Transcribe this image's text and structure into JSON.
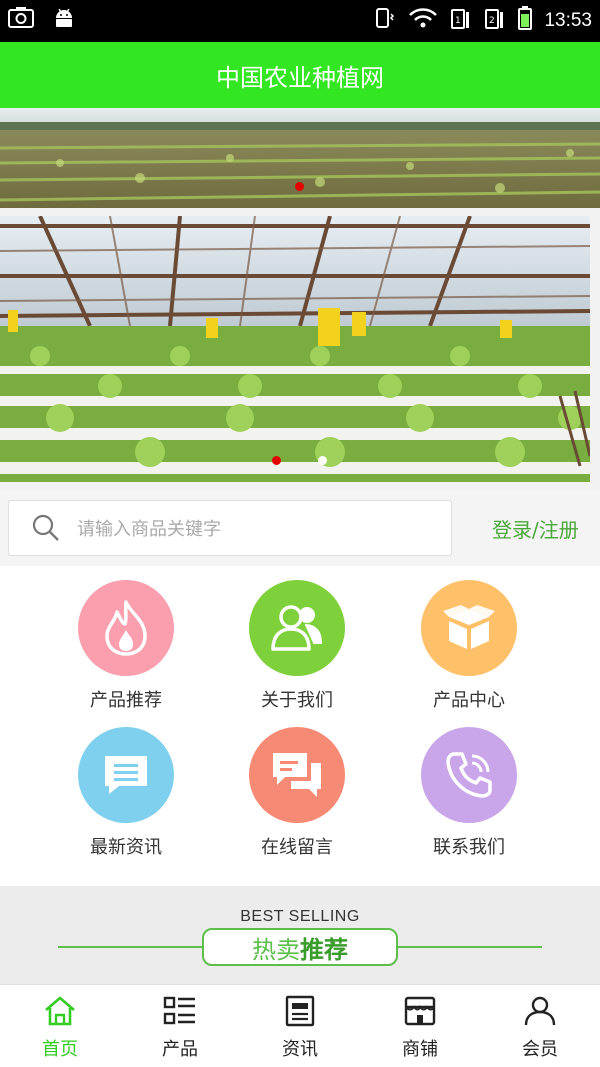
{
  "status": {
    "time": "13:53"
  },
  "header": {
    "title": "中国农业种植网"
  },
  "search": {
    "placeholder": "请输入商品关键字",
    "login_label": "登录/注册"
  },
  "menu": [
    {
      "label": "产品推荐",
      "icon": "fire-icon",
      "color": "#fb9fae"
    },
    {
      "label": "关于我们",
      "icon": "users-icon",
      "color": "#7fd13b"
    },
    {
      "label": "产品中心",
      "icon": "box-icon",
      "color": "#ffc06a"
    },
    {
      "label": "最新资讯",
      "icon": "message-icon",
      "color": "#7fcfef"
    },
    {
      "label": "在线留言",
      "icon": "chat-icon",
      "color": "#f78a74"
    },
    {
      "label": "联系我们",
      "icon": "phone-icon",
      "color": "#c9a6ea"
    }
  ],
  "best_selling": {
    "en": "BEST SELLING",
    "cn_a": "热卖",
    "cn_b": "推荐"
  },
  "tabs": [
    {
      "label": "首页",
      "icon": "home-icon",
      "active": true
    },
    {
      "label": "产品",
      "icon": "list-icon"
    },
    {
      "label": "资讯",
      "icon": "news-icon"
    },
    {
      "label": "商铺",
      "icon": "shop-icon"
    },
    {
      "label": "会员",
      "icon": "user-icon"
    }
  ],
  "colors": {
    "brand": "#33e622",
    "accent": "#4aa83a"
  }
}
